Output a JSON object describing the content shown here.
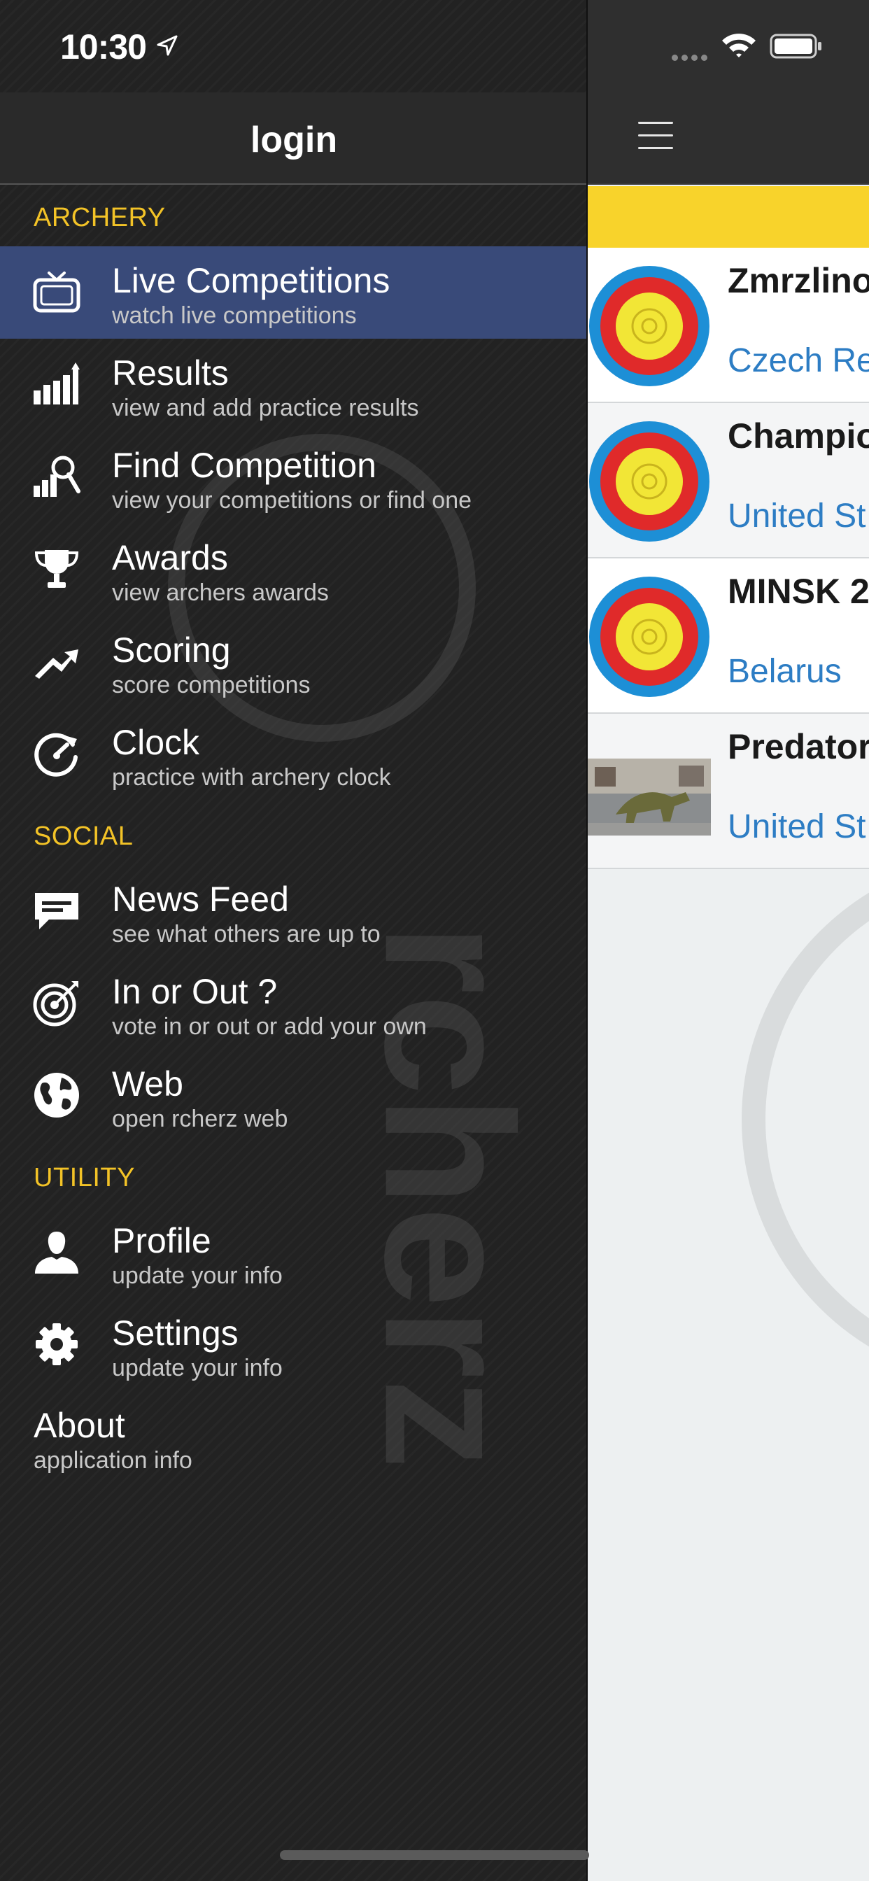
{
  "status_bar": {
    "time": "10:30"
  },
  "drawer": {
    "header_title": "login",
    "sections": [
      {
        "label": "ARCHERY"
      },
      {
        "label": "SOCIAL"
      },
      {
        "label": "UTILITY"
      }
    ],
    "items": [
      {
        "title": "Live Competitions",
        "subtitle": "watch live competitions",
        "icon": "tv-icon",
        "active": true
      },
      {
        "title": "Results",
        "subtitle": "view and add practice results",
        "icon": "bar-chart-icon"
      },
      {
        "title": "Find Competition",
        "subtitle": "view your competitions or find one",
        "icon": "search-chart-icon"
      },
      {
        "title": "Awards",
        "subtitle": "view archers awards",
        "icon": "trophy-icon"
      },
      {
        "title": "Scoring",
        "subtitle": "score competitions",
        "icon": "scoring-arrow-icon"
      },
      {
        "title": "Clock",
        "subtitle": "practice with archery clock",
        "icon": "clock-icon"
      },
      {
        "title": "News Feed",
        "subtitle": "see what others are up to",
        "icon": "chat-bubble-icon"
      },
      {
        "title": "In or Out ?",
        "subtitle": "vote in or out or add your own",
        "icon": "target-arrow-icon"
      },
      {
        "title": "Web",
        "subtitle": "open rcherz web",
        "icon": "globe-icon"
      },
      {
        "title": "Profile",
        "subtitle": "update your info",
        "icon": "person-icon"
      },
      {
        "title": "Settings",
        "subtitle": "update your info",
        "icon": "gear-icon"
      },
      {
        "title": "About",
        "subtitle": "application info"
      }
    ]
  },
  "competitions": [
    {
      "name": "Zmrzlino",
      "country": "Czech Re",
      "thumb": "target-face"
    },
    {
      "name": "Champio",
      "country": "United St",
      "thumb": "target-face"
    },
    {
      "name": "MINSK 2",
      "country": "Belarus",
      "thumb": "target-face"
    },
    {
      "name": "Predator",
      "country": "United St",
      "thumb": "dinosaur-photo"
    }
  ],
  "colors": {
    "accent_yellow": "#f3c327",
    "active_row": "#394a79",
    "country_link": "#2d7dc4",
    "banner_yellow": "#f8d32b"
  }
}
